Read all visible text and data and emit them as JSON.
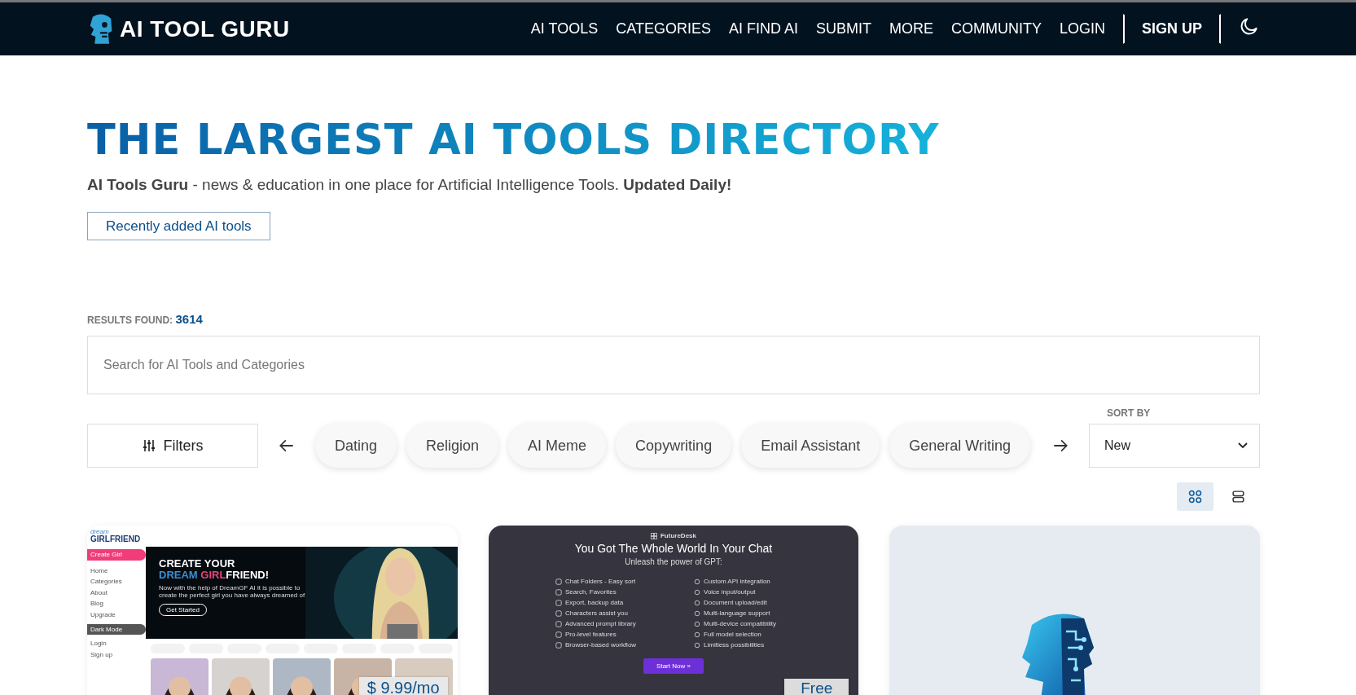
{
  "nav": {
    "logo": "AI TOOL GURU",
    "links": [
      "AI TOOLS",
      "CATEGORIES",
      "AI FIND AI",
      "SUBMIT",
      "MORE",
      "COMMUNITY",
      "LOGIN"
    ],
    "signup": "SIGN UP"
  },
  "hero": {
    "title": "THE LARGEST AI TOOLS DIRECTORY",
    "subtitle": "**AI Tools Guru** - news & education in one place for Artificial Intelligence Tools. **Updated Daily!**",
    "button": "Recently added AI tools"
  },
  "results": {
    "label": "RESULTS FOUND:",
    "count": "3614"
  },
  "search": {
    "placeholder": "Search for AI Tools and Categories"
  },
  "filters": {
    "label": "Filters",
    "chips": [
      "Dating",
      "Religion",
      "AI Meme",
      "Copywriting",
      "Email Assistant",
      "General Writing"
    ],
    "sort_label": "SORT BY",
    "sort_value": "New"
  },
  "views": [
    {
      "kind": "grid",
      "selected": true
    },
    {
      "kind": "list",
      "selected": false
    }
  ],
  "cards": [
    {
      "kind": "girlfriend",
      "logo_top": "dream",
      "logo": "GIRLFRIEND",
      "sidebar": [
        "Create Girl",
        "Home",
        "Categories",
        "About",
        "Blog",
        "Upgrade",
        "Dark Mode",
        "Login",
        "Sign up"
      ],
      "headline": "CREATE YOUR",
      "headline_parts": [
        {
          "text": "DREAM ",
          "color": "#3d8fd1"
        },
        {
          "text": "GIRL",
          "color": "#e8457a"
        },
        {
          "text": "FRIEND!",
          "color": "#ffffff"
        }
      ],
      "description": "Now with the help of DreamGF AI it is possible to create the perfect girl you have always dreamed of",
      "cta": "Get Started",
      "price": "$ 9.99/mo"
    },
    {
      "kind": "futuredesk",
      "brand": "FutureDesk",
      "title": "You Got The Whole World In Your Chat",
      "subtitle": "Unleash the power of GPT:",
      "features_left": [
        "Chat Folders - Easy sort",
        "Search, Favorites",
        "Export, backup data",
        "Characters assist you",
        "Advanced prompt library",
        "Pro-level features",
        "Browser-based workflow"
      ],
      "features_right": [
        "Custom API integration",
        "Voice input/output",
        "Document upload/edit",
        "Multi-language support",
        "Multi-device compatibility",
        "Full model selection",
        "Limitless possibilities"
      ],
      "cta": "Start Now »",
      "price": "Free"
    },
    {
      "kind": "logo"
    }
  ]
}
